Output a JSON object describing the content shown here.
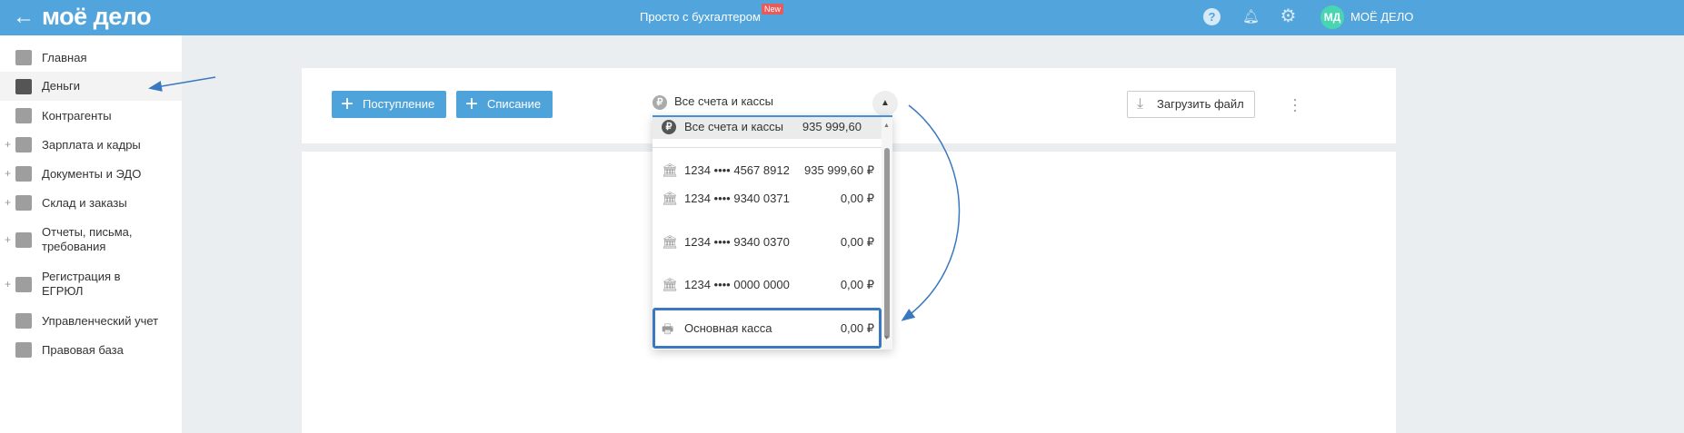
{
  "header": {
    "back_icon": "arrow-left-icon",
    "logo": "моё дело",
    "center_link": "Просто с бухгалтером",
    "new_badge": "New",
    "avatar_initials": "МД",
    "user_name": "МОЁ ДЕЛО",
    "color": "#52a5dc"
  },
  "sidebar": {
    "items": [
      {
        "label": "Главная",
        "icon": "home-icon",
        "expandable": false
      },
      {
        "label": "Деньги",
        "icon": "money-icon",
        "expandable": false,
        "active": true
      },
      {
        "label": "Контрагенты",
        "icon": "person-icon",
        "expandable": false
      },
      {
        "label": "Зарплата и кадры",
        "icon": "wallet-icon",
        "expandable": true
      },
      {
        "label": "Документы и ЭДО",
        "icon": "folder-icon",
        "expandable": true
      },
      {
        "label": "Склад и заказы",
        "icon": "cart-icon",
        "expandable": true
      },
      {
        "label": "Отчеты, письма, требования",
        "icon": "report-icon",
        "expandable": true
      },
      {
        "label": "Регистрация в ЕГРЮЛ",
        "icon": "registration-icon",
        "expandable": true
      },
      {
        "label": "Управленческий учет",
        "icon": "ruble-doc-icon",
        "expandable": false
      },
      {
        "label": "Правовая база",
        "icon": "briefcase-icon",
        "expandable": false
      }
    ],
    "plus": "+"
  },
  "toolbar": {
    "income_label": "Поступление",
    "expense_label": "Списание",
    "account_select": "Все счета и кассы",
    "upload_label": "Загрузить файл"
  },
  "dropdown": {
    "items": [
      {
        "name": "Все счета и кассы",
        "value": "935 999,60",
        "icon": "ruble-icon"
      },
      {
        "name": "1234 •••• 4567 8912",
        "value": "935 999,60 ₽",
        "icon": "bank-icon"
      },
      {
        "name": "1234 •••• 9340 0371",
        "value": "0,00 ₽",
        "icon": "bank-icon"
      },
      {
        "name": "1234 •••• 9340 0370",
        "value": "0,00 ₽",
        "icon": "bank-icon"
      },
      {
        "name": "1234 •••• 0000 0000",
        "value": "0,00 ₽",
        "icon": "bank-icon"
      },
      {
        "name": "Основная касса",
        "value": "0,00 ₽",
        "icon": "cash-register-icon",
        "highlighted": true
      }
    ]
  }
}
